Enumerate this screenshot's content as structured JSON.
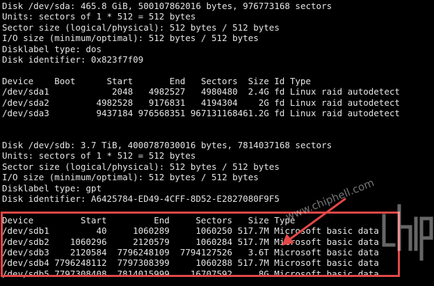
{
  "sda": {
    "header_lines": [
      "Disk /dev/sda: 465.8 GiB, 500107862016 bytes, 976773168 sectors",
      "Units: sectors of 1 * 512 = 512 bytes",
      "Sector size (logical/physical): 512 bytes / 512 bytes",
      "I/O size (minimum/optimal): 512 bytes / 512 bytes",
      "Disklabel type: dos",
      "Disk identifier: 0x823f7f09"
    ],
    "columns": [
      "Device",
      "Boot",
      "Start",
      "End",
      "Sectors",
      "Size",
      "Id",
      "Type"
    ],
    "rows": [
      {
        "device": "/dev/sda1",
        "boot": "",
        "start": "2048",
        "end": "4982527",
        "sectors": "4980480",
        "size": "2.4G",
        "id": "fd",
        "type": "Linux raid autodetect"
      },
      {
        "device": "/dev/sda2",
        "boot": "",
        "start": "4982528",
        "end": "9176831",
        "sectors": "4194304",
        "size": "2G",
        "id": "fd",
        "type": "Linux raid autodetect"
      },
      {
        "device": "/dev/sda3",
        "boot": "",
        "start": "9437184",
        "end": "976568351",
        "sectors": "967131168",
        "size": "461.2G",
        "id": "fd",
        "type": "Linux raid autodetect"
      }
    ]
  },
  "sdb": {
    "header_lines": [
      "Disk /dev/sdb: 3.7 TiB, 4000787030016 bytes, 7814037168 sectors",
      "Units: sectors of 1 * 512 = 512 bytes",
      "Sector size (logical/physical): 512 bytes / 512 bytes",
      "I/O size (minimum/optimal): 512 bytes / 512 bytes",
      "Disklabel type: gpt",
      "Disk identifier: A6425784-ED49-4CFF-8D52-E2827080F9F5"
    ],
    "columns": [
      "Device",
      "Start",
      "End",
      "Sectors",
      "Size",
      "Type"
    ],
    "rows": [
      {
        "device": "/dev/sdb1",
        "start": "40",
        "end": "1060289",
        "sectors": "1060250",
        "size": "517.7M",
        "type": "Microsoft basic data"
      },
      {
        "device": "/dev/sdb2",
        "start": "1060296",
        "end": "2120579",
        "sectors": "1060284",
        "size": "517.7M",
        "type": "Microsoft basic data"
      },
      {
        "device": "/dev/sdb3",
        "start": "2120584",
        "end": "7796248109",
        "sectors": "7794127526",
        "size": "3.6T",
        "type": "Microsoft basic data"
      },
      {
        "device": "/dev/sdb4",
        "start": "7796248112",
        "end": "7797308399",
        "sectors": "1060288",
        "size": "517.7M",
        "type": "Microsoft basic data"
      },
      {
        "device": "/dev/sdb5",
        "start": "7797308408",
        "end": "7814015999",
        "sectors": "16707592",
        "size": "8G",
        "type": "Microsoft basic data"
      }
    ]
  },
  "annotation": {
    "box_color": "#e34848",
    "arrow_color": "#e34848"
  },
  "watermark": {
    "url_text": "www.chiphell.com",
    "logo_text": "chip"
  }
}
